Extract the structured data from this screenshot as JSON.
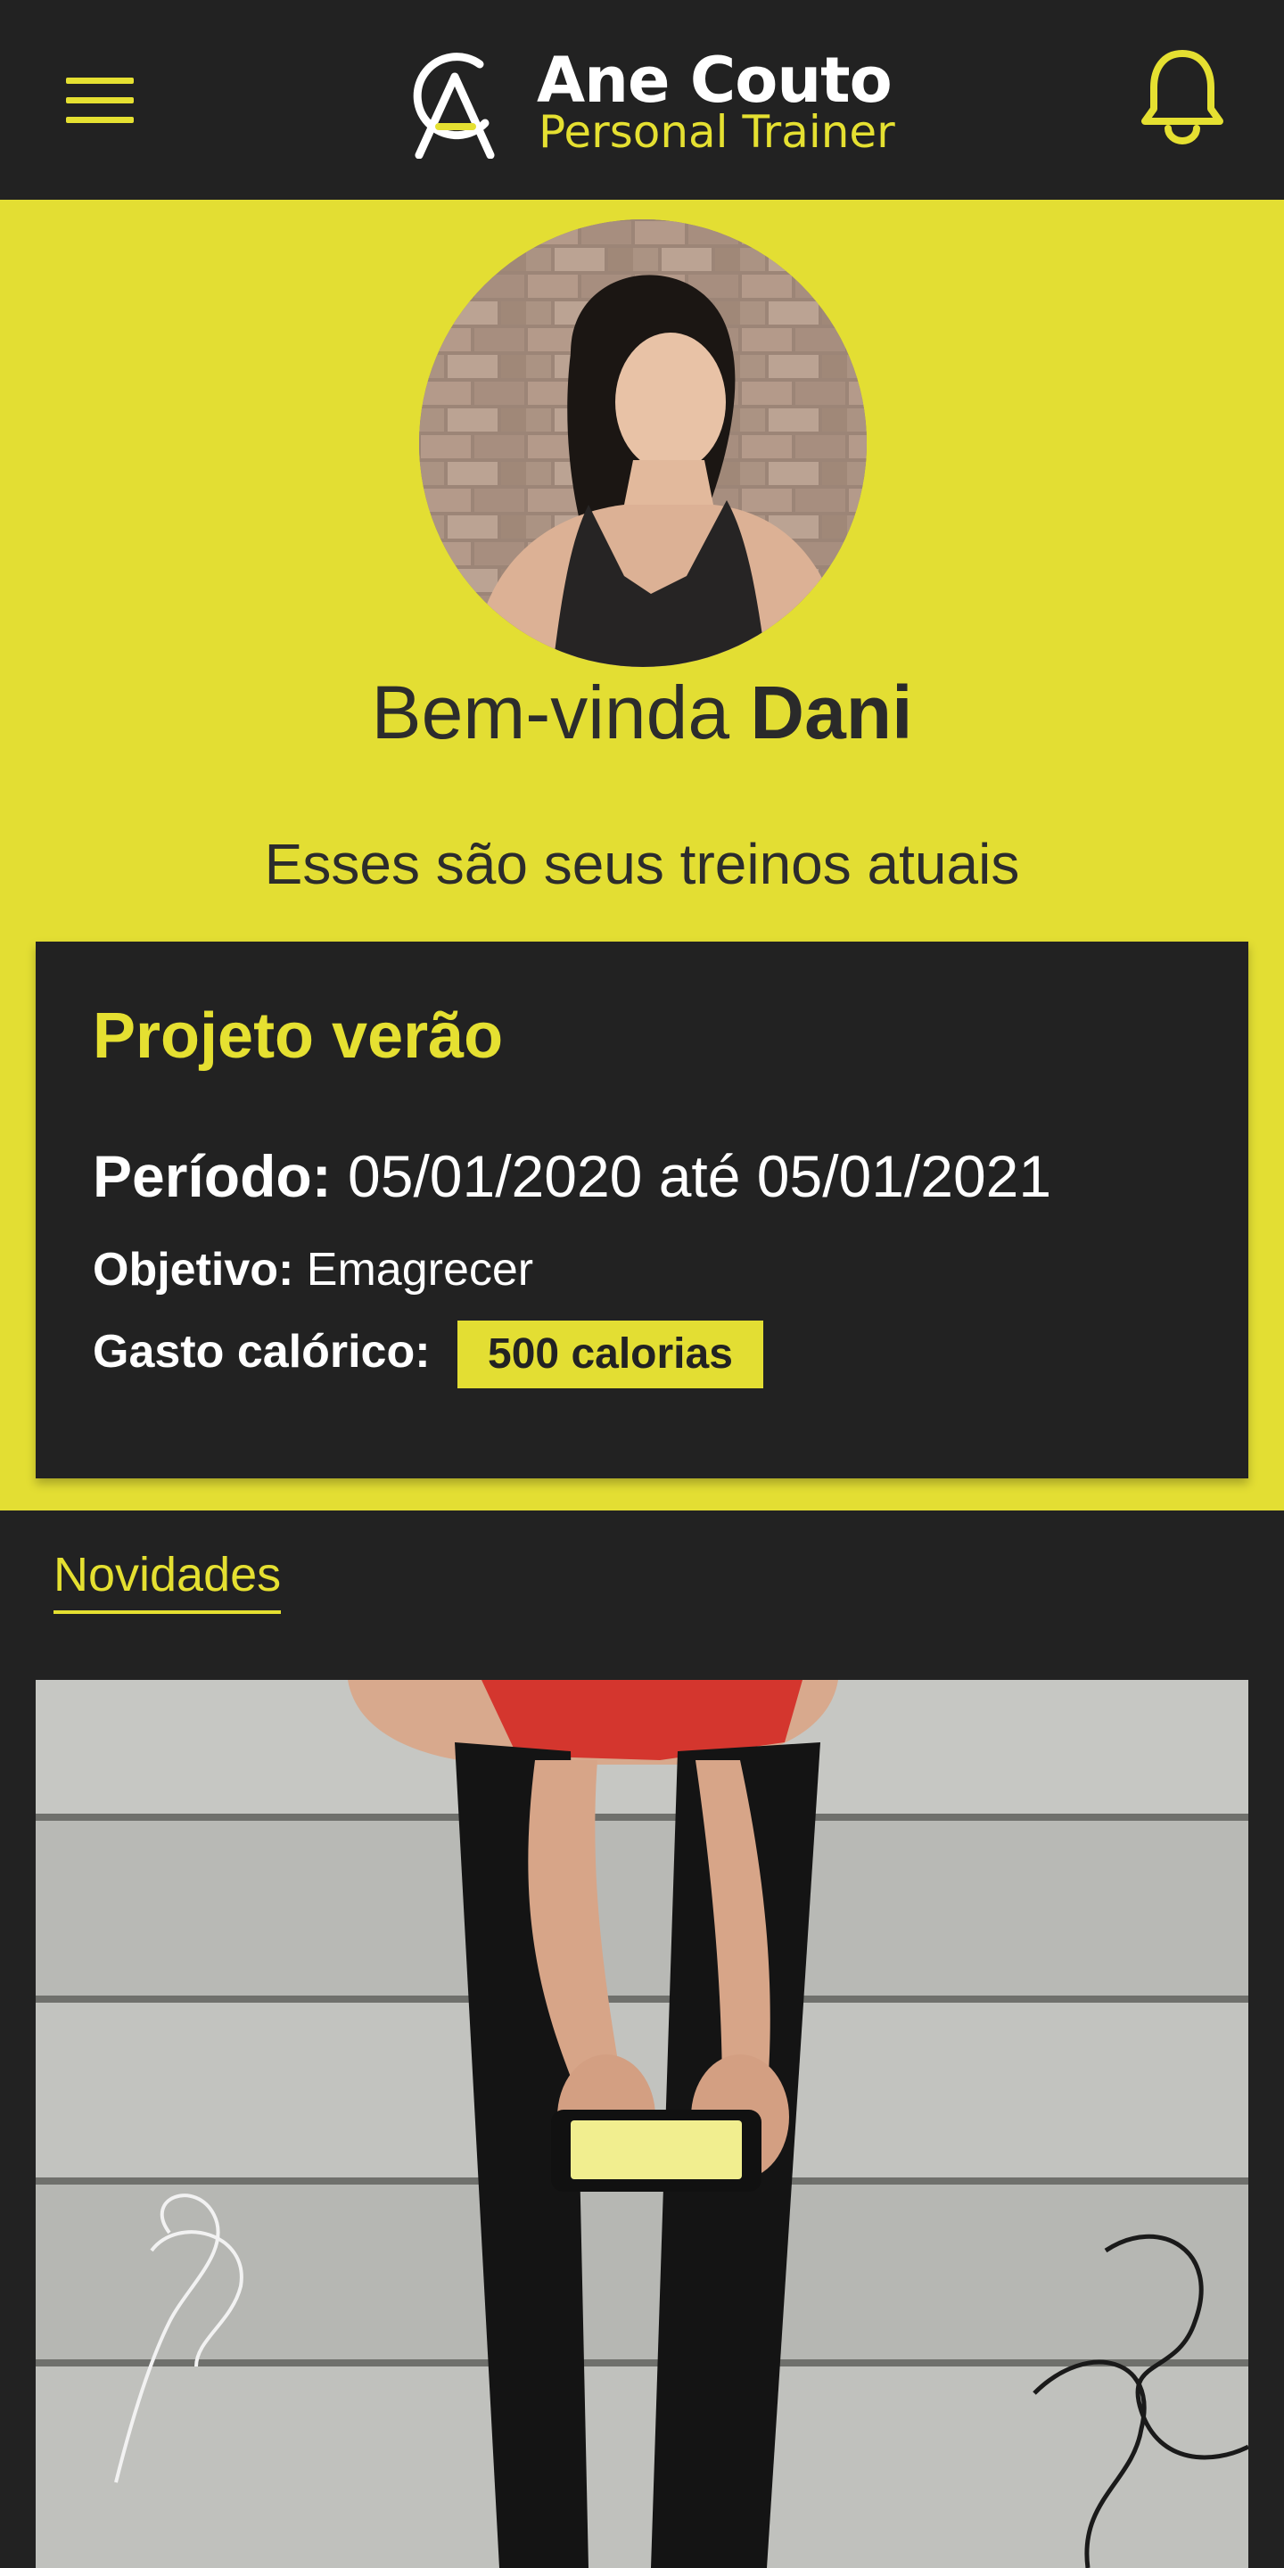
{
  "header": {
    "brand_name": "Ane Couto",
    "brand_subtitle": "Personal Trainer",
    "menu_icon": "hamburger-icon",
    "notification_icon": "bell-icon"
  },
  "colors": {
    "accent": "#e3de33",
    "dark": "#222222",
    "text_dark": "#2c2c2c",
    "text_light": "#ffffff"
  },
  "hero": {
    "greeting": "Bem-vinda",
    "user_name": "Dani",
    "subtitle": "Esses são seus treinos atuais"
  },
  "workout_card": {
    "title": "Projeto verão",
    "period_label": "Período:",
    "period_value": "05/01/2020 até 05/01/2021",
    "goal_label": "Objetivo:",
    "goal_value": "Emagrecer",
    "calories_label": "Gasto calórico:",
    "calories_value": "500 calorias"
  },
  "news": {
    "tab_label": "Novidades"
  }
}
